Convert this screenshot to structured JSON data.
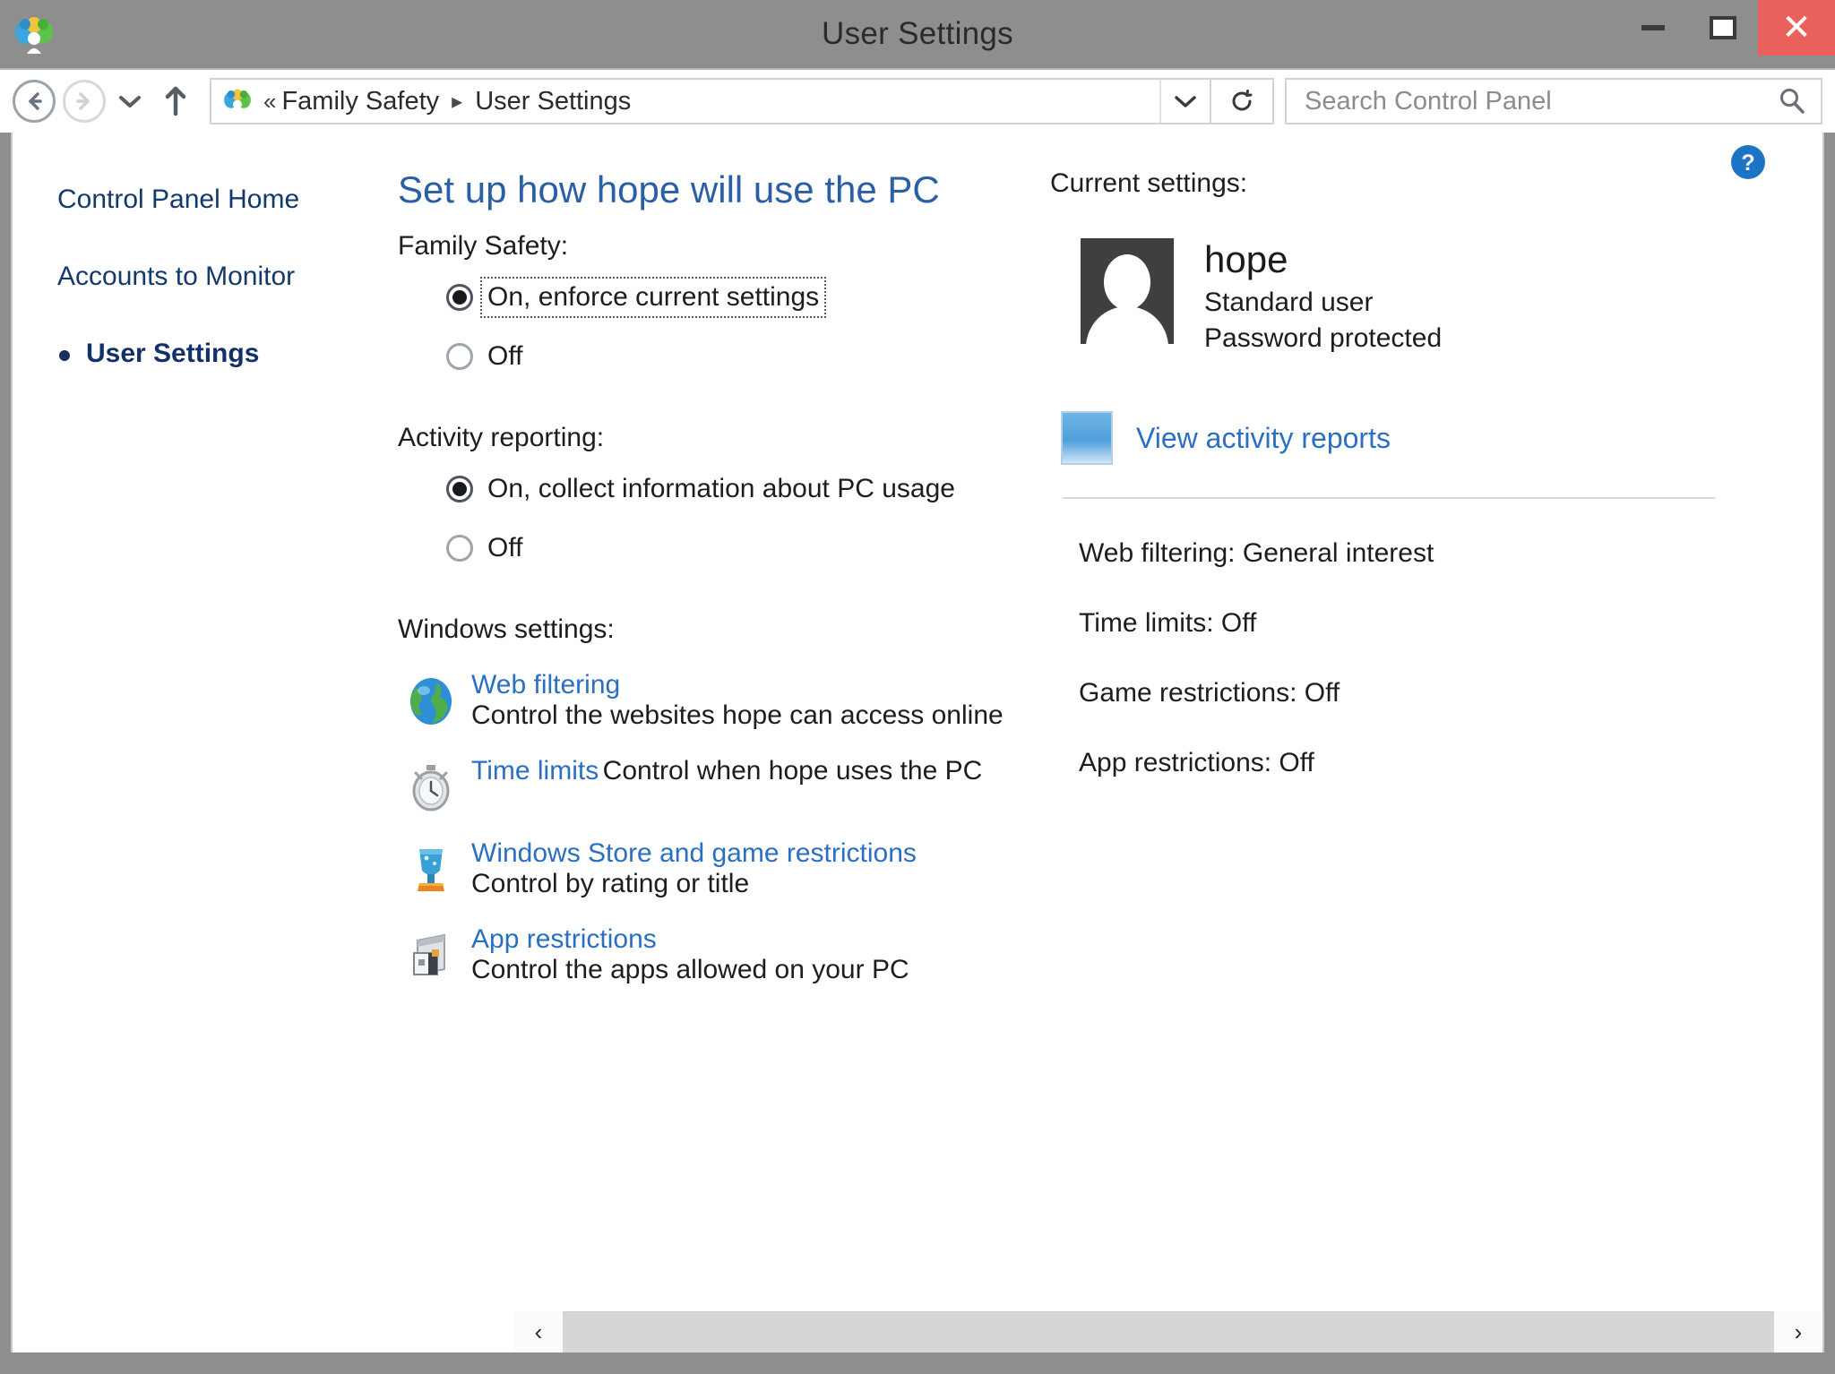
{
  "window": {
    "title": "User Settings",
    "icon": "family-safety-icon",
    "controls": {
      "minimize": "minimize",
      "maximize": "maximize",
      "close": "close"
    }
  },
  "addressbar": {
    "back": "back",
    "forward": "forward",
    "recent": "recent-locations",
    "up": "up-one-level",
    "breadcrumb": {
      "leading": "«",
      "parent": "Family Safety",
      "separator": "▸",
      "current": "User Settings",
      "dropdown": "previous-locations"
    },
    "refresh": "refresh",
    "search": {
      "placeholder": "Search Control Panel",
      "icon": "search-icon"
    }
  },
  "sidebar": {
    "items": [
      {
        "label": "Control Panel Home",
        "current": false
      },
      {
        "label": "Accounts to Monitor",
        "current": false
      },
      {
        "label": "User Settings",
        "current": true
      }
    ]
  },
  "help": {
    "label": "Help",
    "icon": "help-icon"
  },
  "main": {
    "page_title": "Set up how hope will use the PC",
    "family_safety": {
      "label": "Family Safety:",
      "options": [
        {
          "label": "On, enforce current settings",
          "selected": true,
          "focused": true
        },
        {
          "label": "Off",
          "selected": false,
          "focused": false
        }
      ]
    },
    "activity_reporting": {
      "label": "Activity reporting:",
      "options": [
        {
          "label": "On, collect information about PC usage",
          "selected": true,
          "focused": false
        },
        {
          "label": "Off",
          "selected": false,
          "focused": false
        }
      ]
    },
    "windows_settings": {
      "label": "Windows settings:",
      "items": [
        {
          "icon": "globe-icon",
          "link": "Web filtering",
          "description": "Control the websites hope can access online"
        },
        {
          "icon": "stopwatch-icon",
          "link": "Time limits",
          "description": "Control when hope uses the PC"
        },
        {
          "icon": "trophy-icon",
          "link": "Windows Store and game restrictions",
          "description": "Control by rating or title"
        },
        {
          "icon": "app-box-icon",
          "link": "App restrictions",
          "description": "Control the apps allowed on your PC"
        }
      ]
    }
  },
  "right_panel": {
    "heading": "Current settings:",
    "user": {
      "avatar": "user-avatar-icon",
      "name": "hope",
      "account_type": "Standard user",
      "password_state": "Password protected"
    },
    "activity_reports_link": {
      "icon": "report-icon",
      "label": "View activity reports"
    },
    "summary": [
      "Web filtering:  General interest",
      "Time limits:  Off",
      "Game restrictions:  Off",
      "App restrictions:  Off"
    ]
  },
  "scrollbar": {
    "left_arrow": "‹",
    "right_arrow": "›"
  },
  "colors": {
    "title_link": "#2a5fa6",
    "link": "#2a6fc4",
    "sidebar_current": "#14306b",
    "close_button": "#e8615c",
    "chrome": "#8e8e8e"
  }
}
